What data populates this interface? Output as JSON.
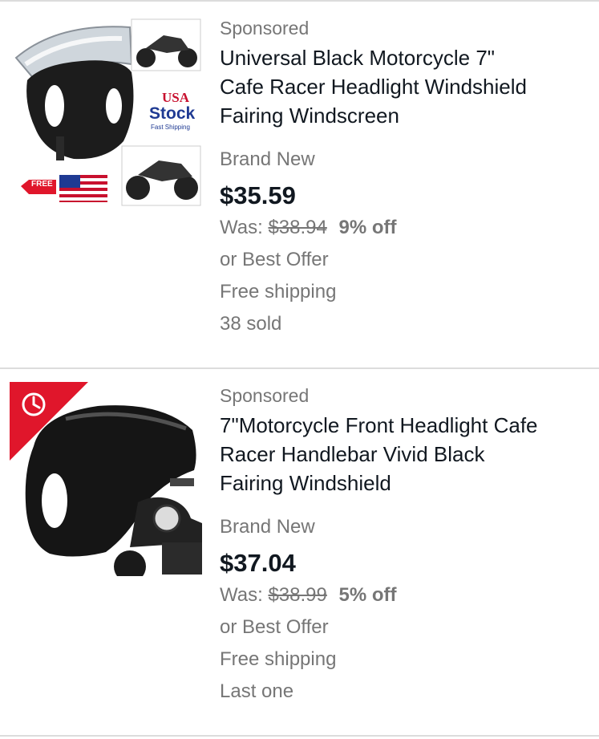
{
  "colors": {
    "text_primary": "#111820",
    "text_secondary": "#767676",
    "divider": "#dcdcdc",
    "deal_badge": "#e0162b"
  },
  "listings": [
    {
      "sponsored": "Sponsored",
      "title_lines": [
        "Universal Black Motorcycle 7\"",
        "Cafe Racer Headlight Windshield",
        "Fairing Windscreen"
      ],
      "condition": "Brand New",
      "price": "$35.59",
      "was_label": "Was:",
      "was_price": "$38.94",
      "discount": "9% off",
      "offer": "or Best Offer",
      "shipping": "Free shipping",
      "sold": "38 sold",
      "thumb_text": {
        "usa": "USA",
        "stock": "Stock",
        "fast": "Fast Shipping",
        "free": "FREE"
      }
    },
    {
      "sponsored": "Sponsored",
      "title_lines": [
        "7\"Motorcycle Front Headlight Cafe",
        "Racer Handlebar Vivid Black",
        "Fairing Windshield"
      ],
      "condition": "Brand New",
      "price": "$37.04",
      "was_label": "Was:",
      "was_price": "$38.99",
      "discount": "5% off",
      "offer": "or Best Offer",
      "shipping": "Free shipping",
      "sold": "Last one",
      "deal_icon": "clock-icon"
    }
  ]
}
